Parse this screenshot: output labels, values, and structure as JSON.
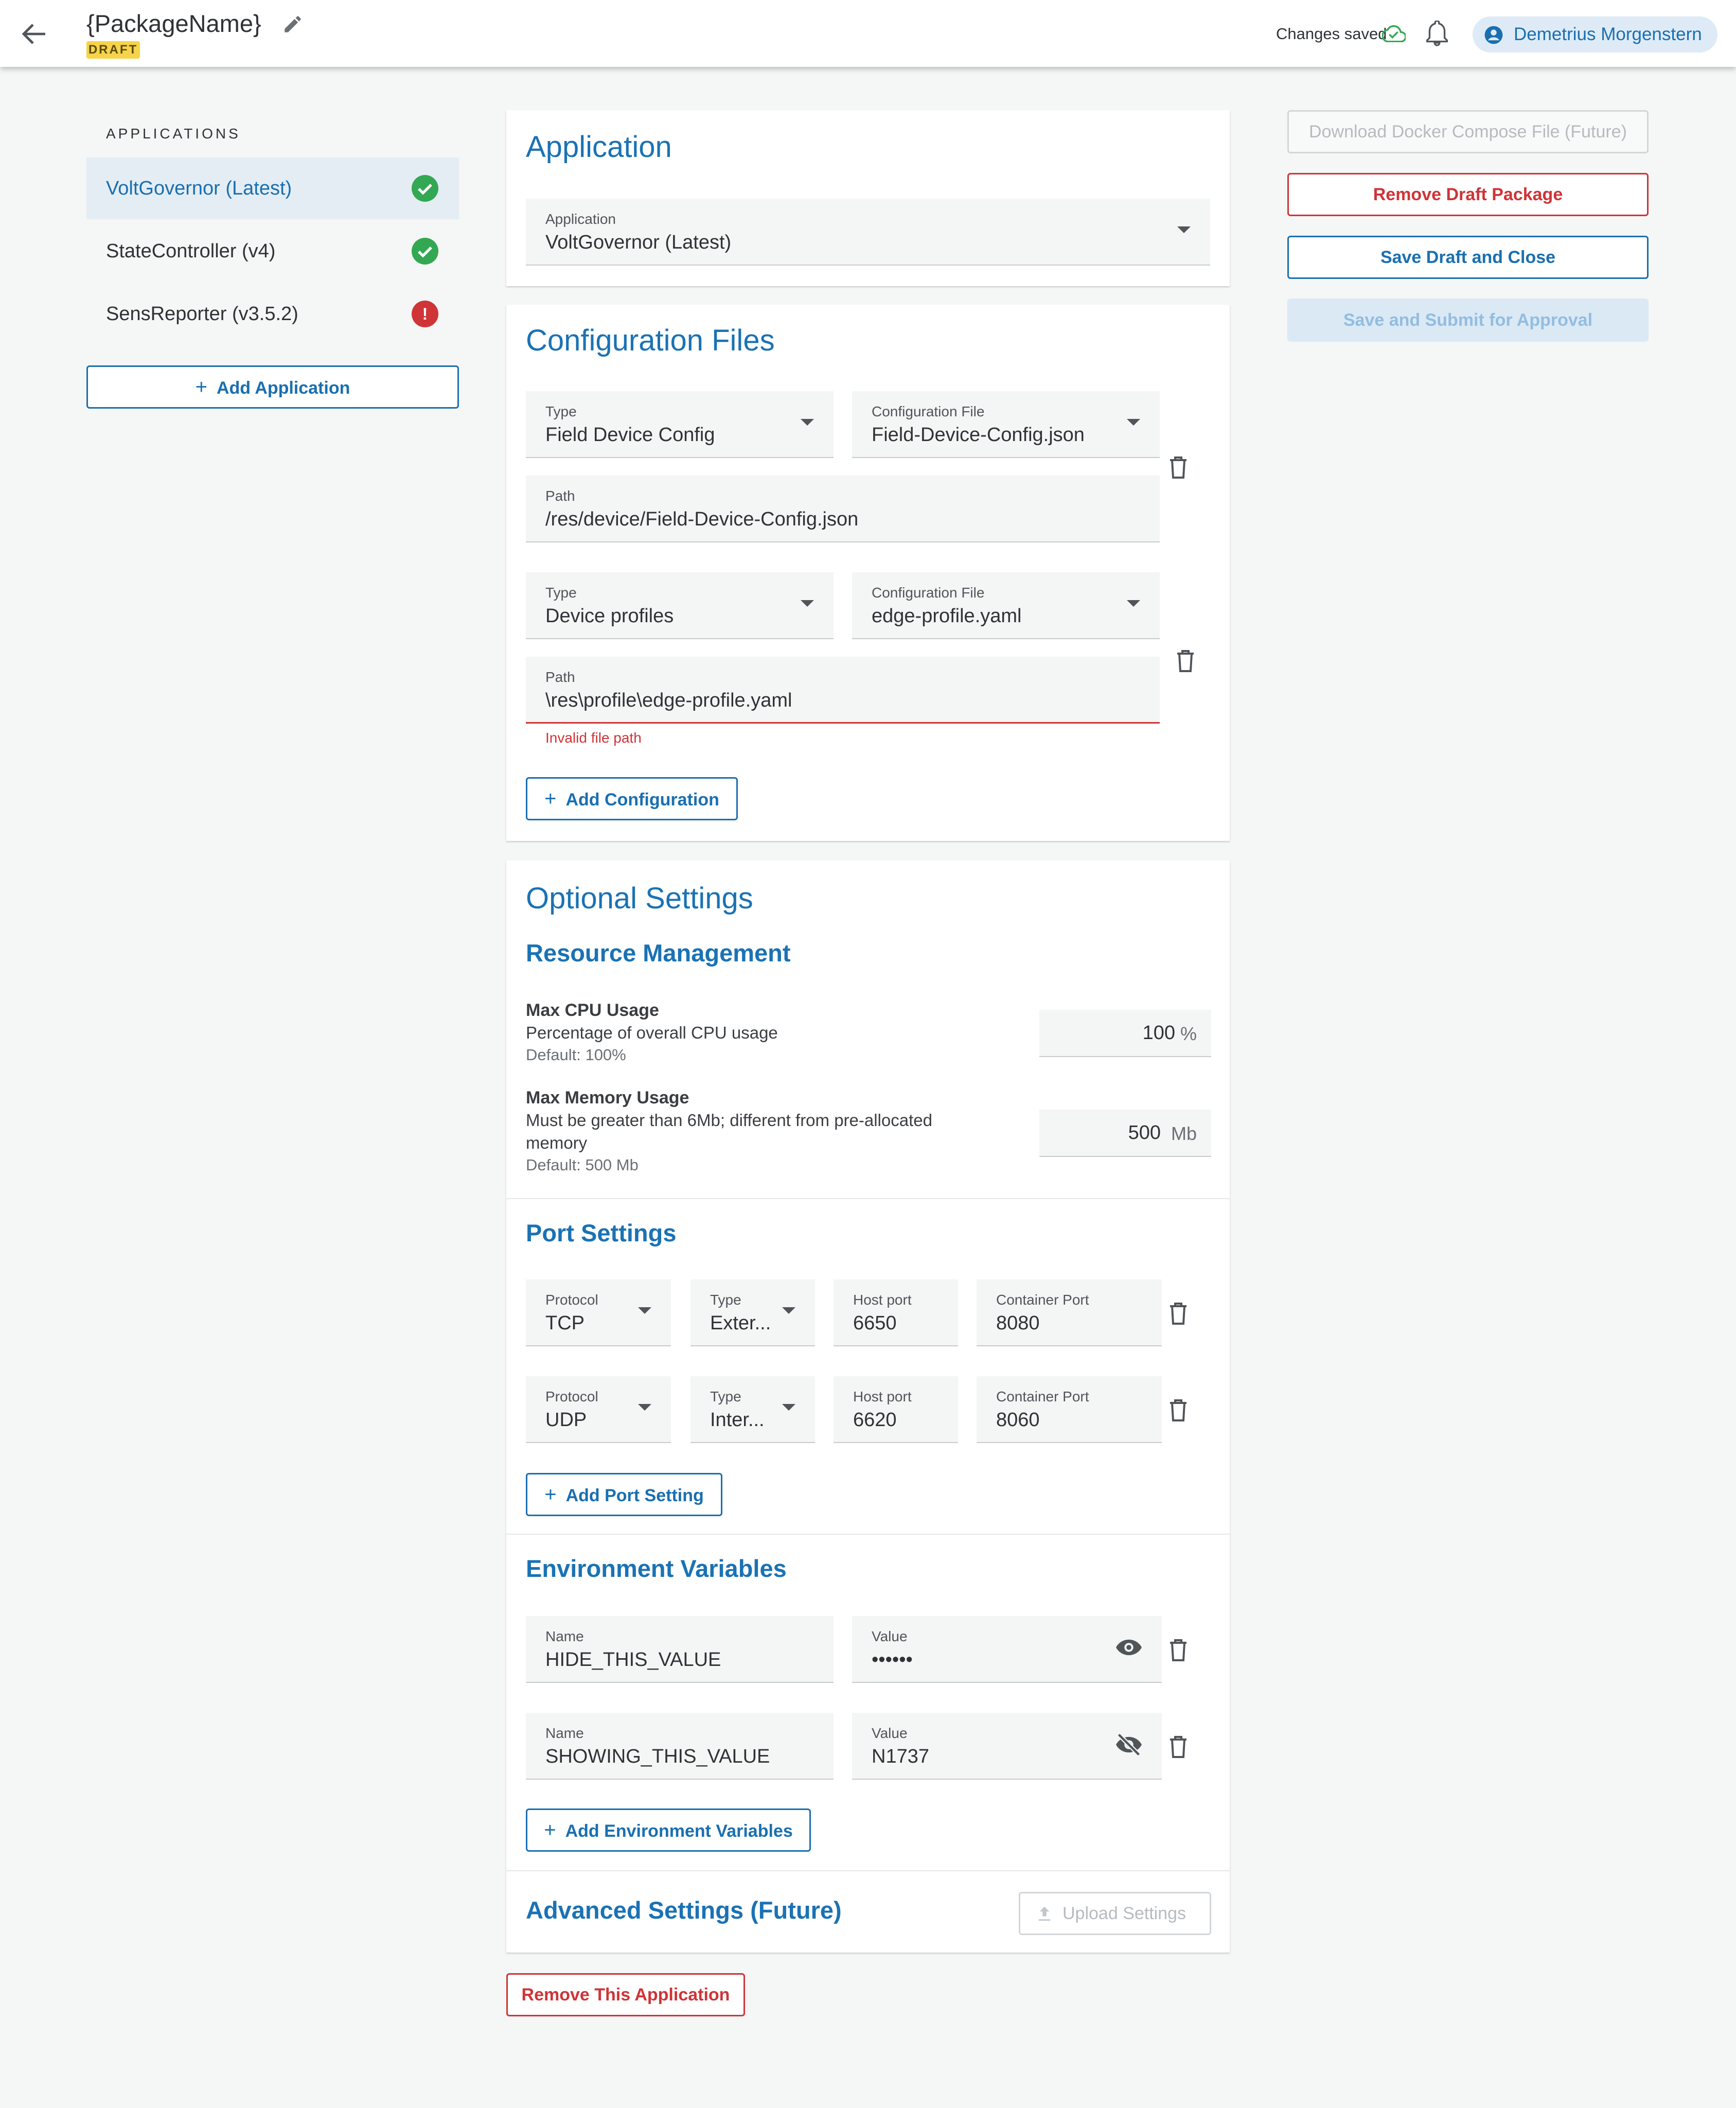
{
  "header": {
    "package_name": "{PackageName}",
    "status_badge": "DRAFT",
    "save_status": "Changes saved",
    "user_name": "Demetrius Morgenstern"
  },
  "sidebar": {
    "heading": "APPLICATIONS",
    "items": [
      {
        "label": "VoltGovernor (Latest)",
        "status": "ok"
      },
      {
        "label": "StateController (v4)",
        "status": "ok"
      },
      {
        "label": "SensReporter (v3.5.2)",
        "status": "error",
        "icon_text": "!"
      }
    ],
    "add_label": "Add Application"
  },
  "actions": {
    "download": "Download Docker Compose File (Future)",
    "remove_draft": "Remove Draft Package",
    "save_close": "Save Draft and Close",
    "submit": "Save and Submit for Approval"
  },
  "application_card": {
    "title": "Application",
    "field_label": "Application",
    "field_value": "VoltGovernor (Latest)"
  },
  "config_card": {
    "title": "Configuration Files",
    "entries": [
      {
        "type_label": "Type",
        "type_value": "Field Device Config",
        "file_label": "Configuration File",
        "file_value": "Field-Device-Config.json",
        "path_label": "Path",
        "path_value": "/res/device/Field-Device-Config.json",
        "error": ""
      },
      {
        "type_label": "Type",
        "type_value": "Device profiles",
        "file_label": "Configuration File",
        "file_value": "edge-profile.yaml",
        "path_label": "Path",
        "path_value": "\\res\\profile\\edge-profile.yaml",
        "error": "Invalid file path"
      }
    ],
    "add_label": "Add Configuration"
  },
  "optional": {
    "title": "Optional Settings",
    "resource": {
      "title": "Resource Management",
      "cpu": {
        "label": "Max CPU Usage",
        "desc": "Percentage of overall CPU usage",
        "default": "Default: 100%",
        "value": "100",
        "unit": "%"
      },
      "memory": {
        "label": "Max Memory Usage",
        "desc1": "Must be greater than 6Mb; different from pre-allocated",
        "desc2": "memory",
        "default": "Default: 500 Mb",
        "value": "500",
        "unit": "Mb"
      }
    },
    "ports": {
      "title": "Port Settings",
      "rows": [
        {
          "protocol_label": "Protocol",
          "protocol": "TCP",
          "type_label": "Type",
          "type": "Exter...",
          "host_label": "Host port",
          "host": "6650",
          "container_label": "Container Port",
          "container": "8080"
        },
        {
          "protocol_label": "Protocol",
          "protocol": "UDP",
          "type_label": "Type",
          "type": "Inter...",
          "host_label": "Host port",
          "host": "6620",
          "container_label": "Container Port",
          "container": "8060"
        }
      ],
      "add_label": "Add Port Setting"
    },
    "env": {
      "title": "Environment Variables",
      "rows": [
        {
          "name_label": "Name",
          "name": "HIDE_THIS_VALUE",
          "value_label": "Value",
          "value": "••••••",
          "visibility": "eye-icon"
        },
        {
          "name_label": "Name",
          "name": "SHOWING_THIS_VALUE",
          "value_label": "Value",
          "value": "N1737",
          "visibility": "eye-off-icon"
        }
      ],
      "add_label": "Add Environment Variables"
    },
    "advanced": {
      "title": "Advanced Settings (Future)",
      "upload_label": "Upload Settings"
    }
  },
  "remove_app_label": "Remove This Application",
  "colors": {
    "accent": "#1a72b4",
    "success": "#33a852",
    "error": "#cf3437",
    "draft": "#f6d34a",
    "disabled_bg": "#dbe9f5"
  }
}
